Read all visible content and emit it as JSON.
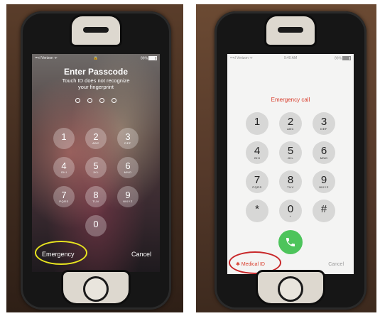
{
  "left": {
    "status": {
      "carrier": "Verizon",
      "battery": "86%"
    },
    "title": "Enter Passcode",
    "subtitle_line1": "Touch ID does not recognize",
    "subtitle_line2": "your fingerprint",
    "keys": [
      {
        "num": "1",
        "letters": ""
      },
      {
        "num": "2",
        "letters": "ABC"
      },
      {
        "num": "3",
        "letters": "DEF"
      },
      {
        "num": "4",
        "letters": "GHI"
      },
      {
        "num": "5",
        "letters": "JKL"
      },
      {
        "num": "6",
        "letters": "MNO"
      },
      {
        "num": "7",
        "letters": "PQRS"
      },
      {
        "num": "8",
        "letters": "TUV"
      },
      {
        "num": "9",
        "letters": "WXYZ"
      },
      {
        "num": "0",
        "letters": ""
      }
    ],
    "emergency_label": "Emergency",
    "cancel_label": "Cancel",
    "highlight_color": "#e8e51f"
  },
  "right": {
    "status": {
      "carrier": "Verizon",
      "time": "9:40 AM",
      "battery": "86%"
    },
    "title": "Emergency call",
    "keys": [
      {
        "num": "1",
        "letters": ""
      },
      {
        "num": "2",
        "letters": "ABC"
      },
      {
        "num": "3",
        "letters": "DEF"
      },
      {
        "num": "4",
        "letters": "GHI"
      },
      {
        "num": "5",
        "letters": "JKL"
      },
      {
        "num": "6",
        "letters": "MNO"
      },
      {
        "num": "7",
        "letters": "PQRS"
      },
      {
        "num": "8",
        "letters": "TUV"
      },
      {
        "num": "9",
        "letters": "WXYZ"
      },
      {
        "num": "*",
        "letters": ""
      },
      {
        "num": "0",
        "letters": "+"
      },
      {
        "num": "#",
        "letters": ""
      }
    ],
    "call_icon": "phone-icon",
    "medical_id_label": "Medical ID",
    "cancel_label": "Cancel",
    "accent_color": "#d83b2a",
    "call_color": "#4dc45b",
    "highlight_color": "#c8282a"
  }
}
